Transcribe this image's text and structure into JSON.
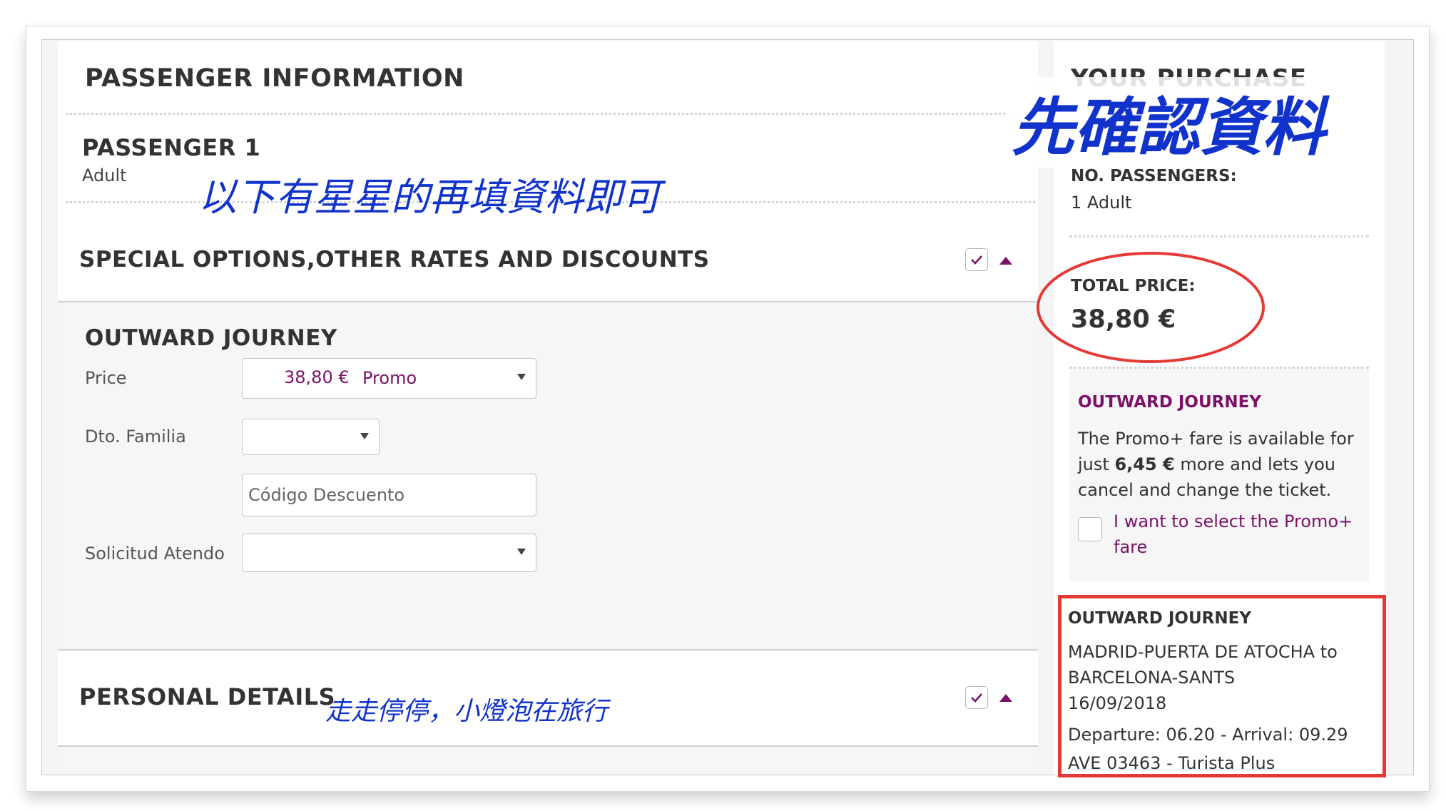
{
  "passenger_info": {
    "title": "PASSENGER INFORMATION",
    "passenger_title": "PASSENGER 1",
    "passenger_type": "Adult"
  },
  "special_options": {
    "title": "SPECIAL OPTIONS,OTHER RATES AND DISCOUNTS"
  },
  "outward_form": {
    "title": "OUTWARD JOURNEY",
    "price_label": "Price",
    "price_amount": "38,80 €",
    "price_fare": "Promo",
    "familia_label": "Dto. Familia",
    "codigo_placeholder": "Código Descuento",
    "solicitud_label": "Solicitud Atendo"
  },
  "personal_details": {
    "title": "PERSONAL DETAILS"
  },
  "purchase": {
    "title": "YOUR PURCHASE",
    "passengers_label": "NO. PASSENGERS:",
    "passengers_value": "1 Adult",
    "total_label": "TOTAL PRICE:",
    "total_value": "38,80 €",
    "upsell_title": "OUTWARD JOURNEY",
    "upsell_line1": "The Promo+ fare is available for",
    "upsell_line2_pre": "just",
    "upsell_line2_bold": "6,45 €",
    "upsell_line2_post": "more and lets you",
    "upsell_line3": "cancel and change the ticket.",
    "upsell_checkbox_line1": "I want to select the Promo+",
    "upsell_checkbox_line2": "fare",
    "journey_title": "OUTWARD JOURNEY",
    "journey_route1": "MADRID-PUERTA DE ATOCHA to",
    "journey_route2": "BARCELONA-SANTS",
    "journey_date": "16/09/2018",
    "journey_times": "Departure: 06.20 - Arrival: 09.29",
    "journey_train": "AVE 03463 - Turista Plus"
  },
  "annotations": {
    "confirm_data": "先確認資料",
    "fill_starred": "以下有星星的再填資料即可",
    "watermark": "走走停停，小燈泡在旅行"
  },
  "colors": {
    "accent_purple": "#7b1268",
    "annotation_blue": "#1133cc",
    "highlight_red": "#e53935"
  }
}
